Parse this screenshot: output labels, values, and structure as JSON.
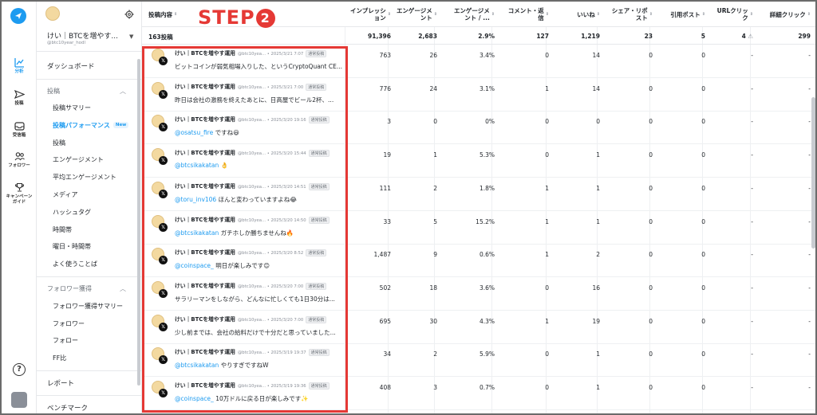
{
  "overlay": {
    "step_text": "STEP",
    "step_number": "2"
  },
  "rail": {
    "items": [
      {
        "label": "分析",
        "icon": "chart-line-icon",
        "active": true
      },
      {
        "label": "投稿",
        "icon": "send-icon",
        "active": false
      },
      {
        "label": "受信箱",
        "icon": "inbox-icon",
        "active": false
      },
      {
        "label": "フォロワー",
        "icon": "users-icon",
        "active": false
      },
      {
        "label": "キャンペーン\nガイド",
        "icon": "trophy-icon",
        "active": false
      }
    ],
    "help_label": "?"
  },
  "account": {
    "name": "けい｜BTCを増やす...",
    "handle": "@btc10year_hodl"
  },
  "sidebar": {
    "dashboard": "ダッシュボード",
    "group_posts": "投稿",
    "posts_items": [
      "投稿サマリー",
      "投稿パフォーマンス",
      "投稿",
      "エンゲージメント",
      "平均エンゲージメント",
      "メディア",
      "ハッシュタグ",
      "時間帯",
      "曜日・時間帯",
      "よく使うことば"
    ],
    "new_badge": "New",
    "group_followers": "フォロワー獲得",
    "followers_items": [
      "フォロワー獲得サマリー",
      "フォロワー",
      "フォロー",
      "FF比"
    ],
    "report": "レポート",
    "benchmark": "ベンチマーク"
  },
  "table": {
    "headers": [
      "投稿内容",
      "インプレッション",
      "エンゲージメント",
      "エンゲージメント / ...",
      "コメント・返信",
      "いいね",
      "シェア・リポスト",
      "引用ポスト",
      "URLクリック",
      "詳細クリック"
    ],
    "totals": [
      "163投稿",
      "91,396",
      "2,683",
      "2.9%",
      "127",
      "1,219",
      "23",
      "5",
      "4",
      "299"
    ],
    "rows": [
      {
        "author": "けい｜BTCを増やす運用",
        "meta": "@btc10yea... • 2025/3/21 7:07",
        "tag": "通常投稿",
        "mention": "",
        "text": "ビットコインが弱気相場入りした、というCryptoQuant CE...",
        "values": [
          "763",
          "26",
          "3.4%",
          "0",
          "14",
          "0",
          "0",
          "-",
          "-"
        ]
      },
      {
        "author": "けい｜BTCを増やす運用",
        "meta": "@btc10yea... • 2025/3/21 7:00",
        "tag": "通常投稿",
        "mention": "",
        "text": "昨日は会社の激務を終えたあとに、日高屋でビール2杯、...",
        "values": [
          "776",
          "24",
          "3.1%",
          "1",
          "14",
          "0",
          "0",
          "-",
          "-"
        ]
      },
      {
        "author": "けい｜BTCを増やす運用",
        "meta": "@btc10yea... • 2025/3/20 19:16",
        "tag": "通常投稿",
        "mention": "@osatsu_fire",
        "text": " ですね😃",
        "values": [
          "3",
          "0",
          "0%",
          "0",
          "0",
          "0",
          "0",
          "-",
          "-"
        ]
      },
      {
        "author": "けい｜BTCを増やす運用",
        "meta": "@btc10yea... • 2025/3/20 15:44",
        "tag": "通常投稿",
        "mention": "@btcsikakatan",
        "text": " 👌",
        "values": [
          "19",
          "1",
          "5.3%",
          "0",
          "1",
          "0",
          "0",
          "-",
          "-"
        ]
      },
      {
        "author": "けい｜BTCを増やす運用",
        "meta": "@btc10yea... • 2025/3/20 14:51",
        "tag": "通常投稿",
        "mention": "@toru_inv106",
        "text": " ほんと変わっていますよね😂",
        "values": [
          "111",
          "2",
          "1.8%",
          "1",
          "1",
          "0",
          "0",
          "-",
          "-"
        ]
      },
      {
        "author": "けい｜BTCを増やす運用",
        "meta": "@btc10yea... • 2025/3/20 14:50",
        "tag": "通常投稿",
        "mention": "@btcsikakatan",
        "text": " ガチホしか勝ちませんね🔥",
        "values": [
          "33",
          "5",
          "15.2%",
          "1",
          "1",
          "0",
          "0",
          "-",
          "-"
        ]
      },
      {
        "author": "けい｜BTCを増やす運用",
        "meta": "@btc10yea... • 2025/3/20 8:52",
        "tag": "通常投稿",
        "mention": "@coinspace_",
        "text": " 明日が楽しみです😊",
        "values": [
          "1,487",
          "9",
          "0.6%",
          "1",
          "2",
          "0",
          "0",
          "-",
          "-"
        ]
      },
      {
        "author": "けい｜BTCを増やす運用",
        "meta": "@btc10yea... • 2025/3/20 7:00",
        "tag": "通常投稿",
        "mention": "",
        "text": "サラリーマンをしながら、どんなに忙しくても1日30分は...",
        "values": [
          "502",
          "18",
          "3.6%",
          "0",
          "16",
          "0",
          "0",
          "-",
          "-"
        ]
      },
      {
        "author": "けい｜BTCを増やす運用",
        "meta": "@btc10yea... • 2025/3/20 7:00",
        "tag": "通常投稿",
        "mention": "",
        "text": "少し前までは、会社の給料だけで十分だと思っていました...",
        "values": [
          "695",
          "30",
          "4.3%",
          "1",
          "19",
          "0",
          "0",
          "-",
          "-"
        ]
      },
      {
        "author": "けい｜BTCを増やす運用",
        "meta": "@btc10yea... • 2025/3/19 19:37",
        "tag": "通常投稿",
        "mention": "@btcsikakatan",
        "text": " やりすぎですねW",
        "values": [
          "34",
          "2",
          "5.9%",
          "0",
          "1",
          "0",
          "0",
          "-",
          "-"
        ]
      },
      {
        "author": "けい｜BTCを増やす運用",
        "meta": "@btc10yea... • 2025/3/19 19:36",
        "tag": "通常投稿",
        "mention": "@coinspace_",
        "text": " 10万ドルに戻る日が楽しみです✨",
        "values": [
          "408",
          "3",
          "0.7%",
          "0",
          "1",
          "0",
          "0",
          "-",
          "-"
        ]
      }
    ]
  },
  "colors": {
    "accent": "#1d9bf0",
    "highlight": "#e53935"
  }
}
